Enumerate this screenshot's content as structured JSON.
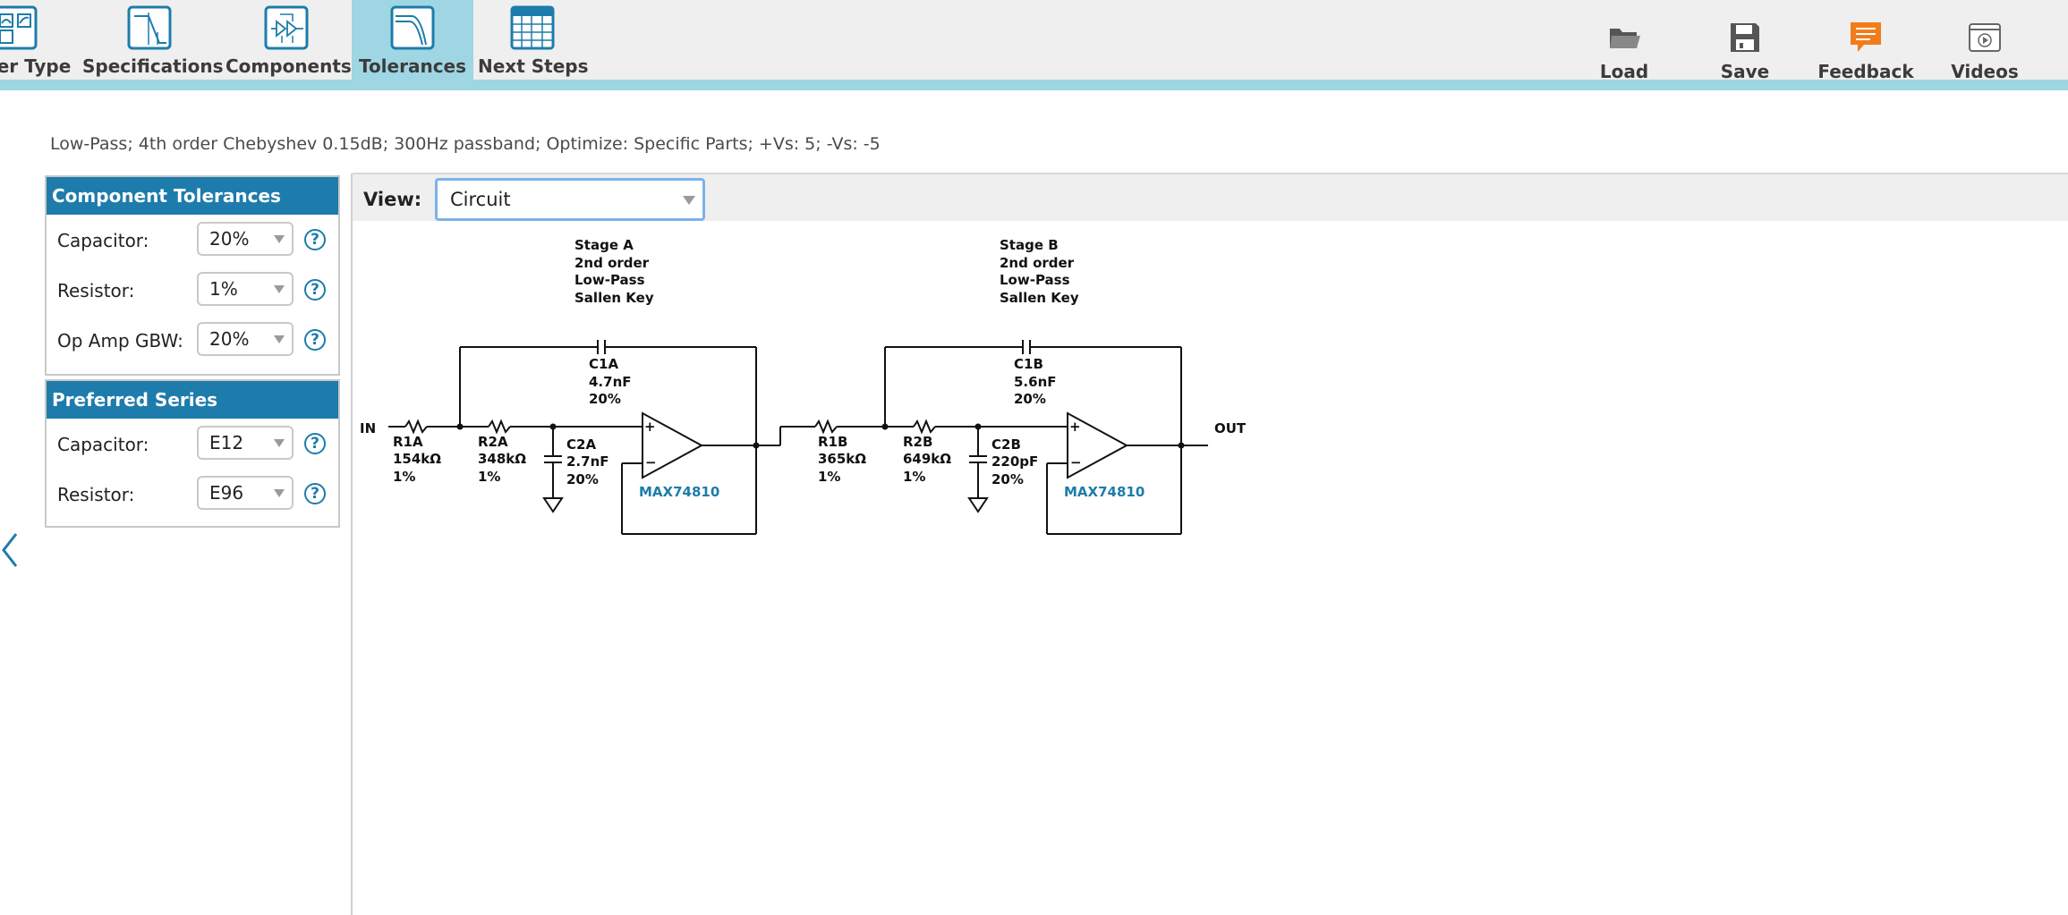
{
  "nav": {
    "items": [
      {
        "label": "er Type",
        "icon": "filter-type-icon"
      },
      {
        "label": "Specifications",
        "icon": "specifications-icon"
      },
      {
        "label": "Components",
        "icon": "components-icon"
      },
      {
        "label": "Tolerances",
        "icon": "tolerances-icon",
        "active": true
      },
      {
        "label": "Next Steps",
        "icon": "next-steps-icon"
      }
    ]
  },
  "actions": {
    "load": "Load",
    "save": "Save",
    "feedback": "Feedback",
    "videos": "Videos"
  },
  "summary": "Low-Pass; 4th order Chebyshev 0.15dB; 300Hz passband; Optimize: Specific Parts; +Vs: 5; -Vs: -5",
  "tolerances": {
    "title": "Component Tolerances",
    "rows": [
      {
        "label": "Capacitor:",
        "value": "20%"
      },
      {
        "label": "Resistor:",
        "value": "1%"
      },
      {
        "label": "Op Amp GBW:",
        "value": "20%"
      }
    ]
  },
  "series": {
    "title": "Preferred Series",
    "rows": [
      {
        "label": "Capacitor:",
        "value": "E12"
      },
      {
        "label": "Resistor:",
        "value": "E96"
      }
    ]
  },
  "help_glyph": "?",
  "view": {
    "label": "View:",
    "value": "Circuit"
  },
  "circuit": {
    "in_label": "IN",
    "out_label": "OUT",
    "stage_a": {
      "title": [
        "Stage A",
        "2nd order",
        "Low-Pass",
        "Sallen Key"
      ],
      "r1": [
        "R1A",
        "154kΩ",
        "1%"
      ],
      "r2": [
        "R2A",
        "348kΩ",
        "1%"
      ],
      "c1": [
        "C1A",
        "4.7nF",
        "20%"
      ],
      "c2": [
        "C2A",
        "2.7nF",
        "20%"
      ],
      "opamp": "MAX74810"
    },
    "stage_b": {
      "title": [
        "Stage B",
        "2nd order",
        "Low-Pass",
        "Sallen Key"
      ],
      "r1": [
        "R1B",
        "365kΩ",
        "1%"
      ],
      "r2": [
        "R2B",
        "649kΩ",
        "1%"
      ],
      "c1": [
        "C1B",
        "5.6nF",
        "20%"
      ],
      "c2": [
        "C2B",
        "220pF",
        "20%"
      ],
      "opamp": "MAX74810"
    },
    "plus": "+",
    "minus": "−"
  },
  "colors": {
    "accent": "#1d7cab",
    "active_tab": "#9fd6e3",
    "feedback": "#f07d1a"
  }
}
